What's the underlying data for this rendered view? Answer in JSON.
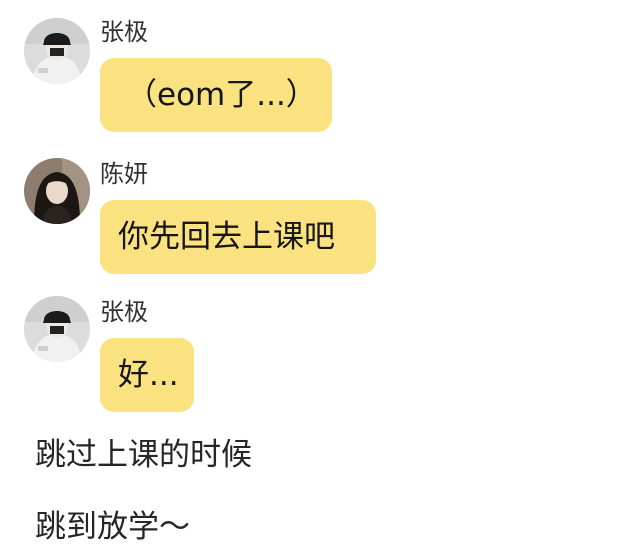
{
  "messages": [
    {
      "sender": "张极",
      "text": "（eom了...）",
      "avatar_icon": "user-avatar-black-hat-icon"
    },
    {
      "sender": "陈妍",
      "text": "你先回去上课吧",
      "avatar_icon": "user-avatar-dark-hair-icon"
    },
    {
      "sender": "张极",
      "text": "好...",
      "avatar_icon": "user-avatar-black-hat-icon"
    }
  ],
  "narration": [
    "跳过上课的时候",
    "跳到放学～"
  ],
  "colors": {
    "bubble": "#fae280",
    "background": "#ffffff",
    "text": "#222222"
  }
}
